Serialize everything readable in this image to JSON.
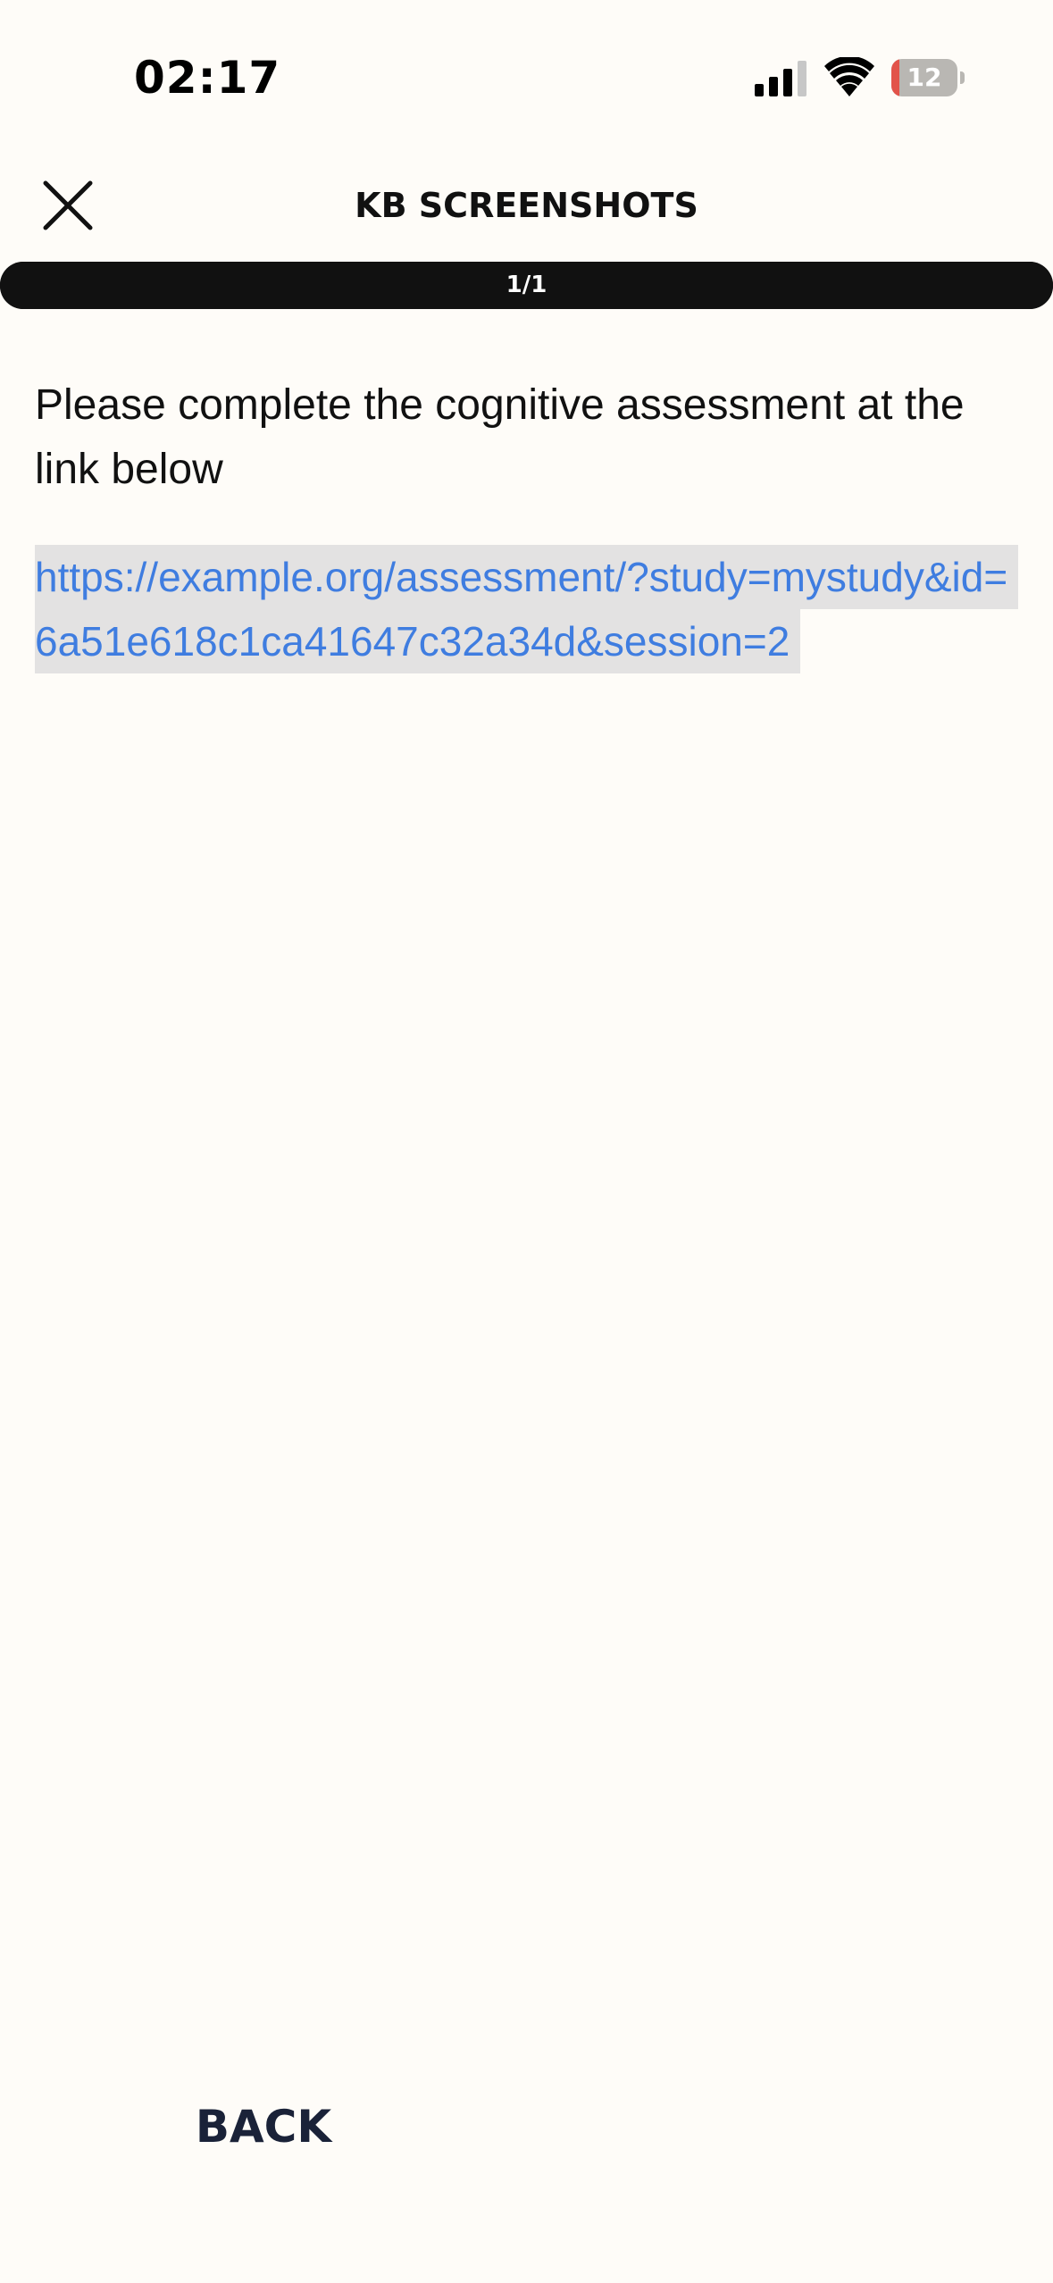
{
  "status_bar": {
    "time": "02:17",
    "battery_percent": 12,
    "battery_text": "12",
    "battery_low_color": "#e2534a",
    "signal_bars_active": 3,
    "signal_bars_total": 4,
    "icons": [
      "cellular-signal-icon",
      "wifi-icon",
      "battery-icon"
    ]
  },
  "nav": {
    "title": "KB SCREENSHOTS",
    "close_icon": "close-icon"
  },
  "progress": {
    "label": "1/1",
    "current": 1,
    "total": 1
  },
  "content": {
    "instruction": "Please complete the cognitive assessment at the link below",
    "link": " https://example.org/assessment/?study=mystudy&id=6a51e618c1ca41647c32a34d&session=2 ",
    "link_color": "#3f7de0"
  },
  "footer": {
    "back_label": "BACK"
  }
}
